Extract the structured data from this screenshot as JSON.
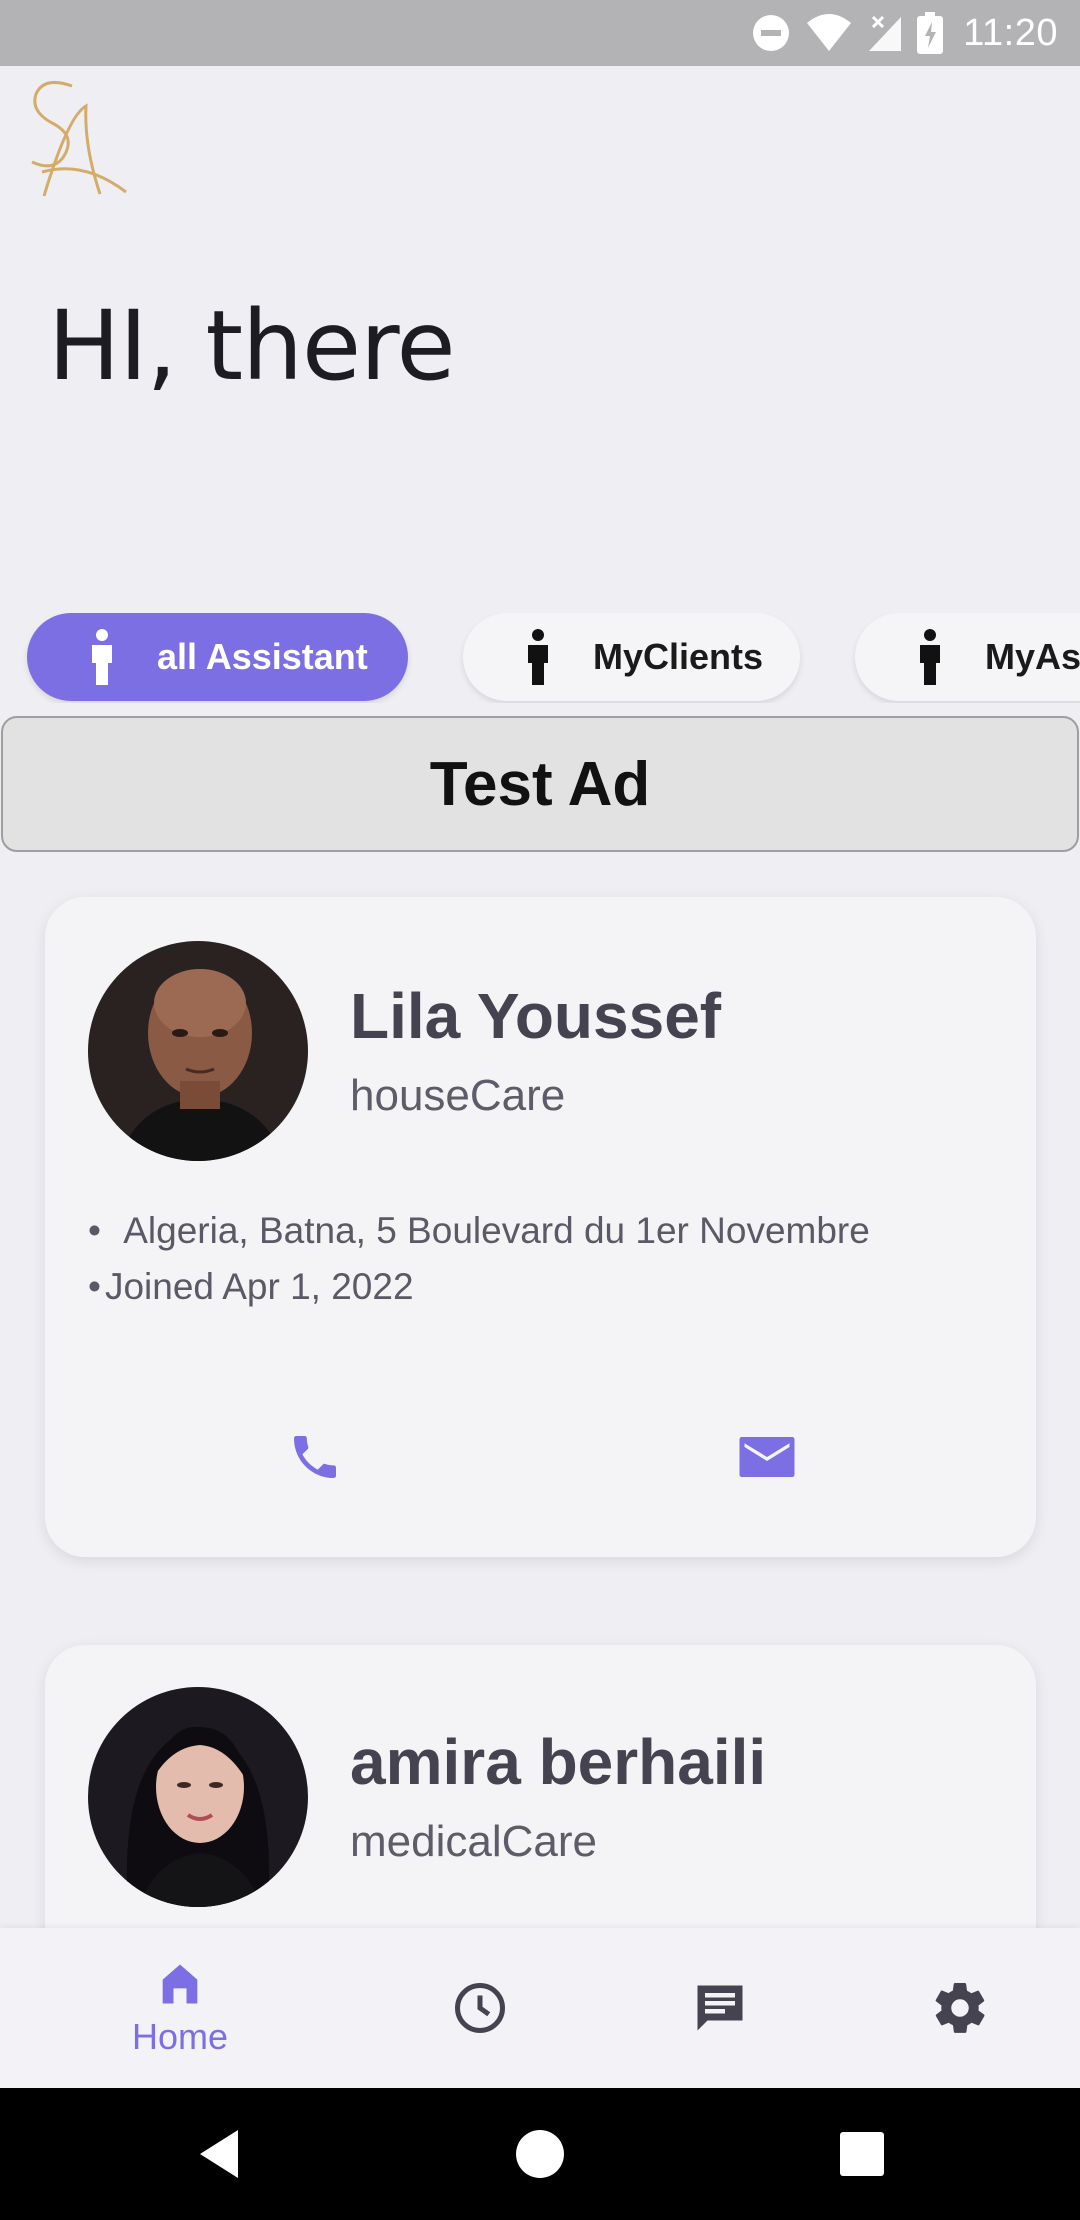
{
  "status_bar": {
    "time": "11:20",
    "icons": [
      "do-not-disturb-icon",
      "wifi-icon",
      "signal-icon",
      "battery-icon"
    ]
  },
  "app": {
    "logo_text": "SA",
    "greeting": "HI, there"
  },
  "filters": {
    "chips": [
      {
        "label": "all Assistant",
        "icon": "person-icon",
        "active": true
      },
      {
        "label": "MyClients",
        "icon": "person-icon",
        "active": false
      },
      {
        "label": "MyAs",
        "icon": "person-icon",
        "active": false
      }
    ]
  },
  "ad": {
    "label": "Test Ad"
  },
  "assistants": [
    {
      "name": "Lila Youssef",
      "category": "houseCare",
      "address": "Algeria, Batna, 5 Boulevard du 1er Novembre",
      "joined": "Joined Apr 1, 2022",
      "bullet": "•"
    },
    {
      "name": "amira berhaili",
      "category": "medicalCare"
    }
  ],
  "bottom_nav": {
    "items": [
      {
        "label": "Home",
        "icon": "home-icon",
        "active": true
      },
      {
        "icon": "history-icon"
      },
      {
        "icon": "chat-icon"
      },
      {
        "icon": "settings-icon"
      }
    ]
  },
  "colors": {
    "accent": "#7b6fe3",
    "background": "#efeef3",
    "card": "#f4f3f6",
    "gold": "#d4ac6a"
  }
}
